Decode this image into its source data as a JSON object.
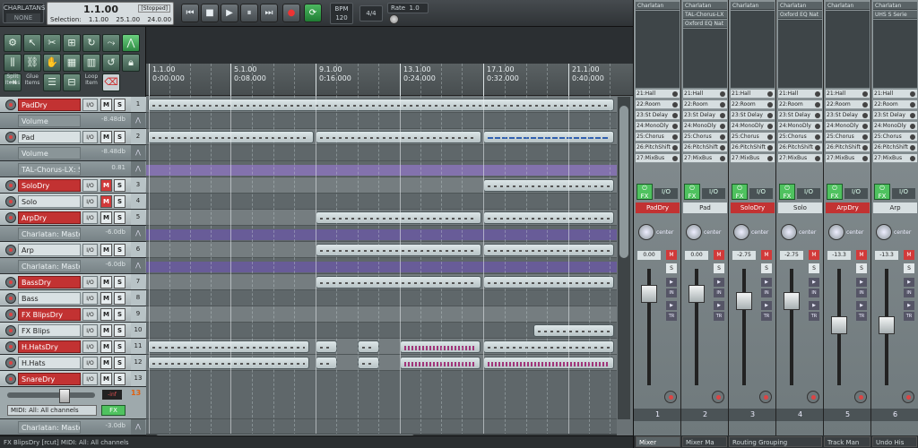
{
  "transport": {
    "project_name": "CHARLATANS",
    "project_sub": "NONE",
    "time_position": "1.1.00",
    "time_status": "[Stopped]",
    "selection_label": "Selection:",
    "selection_start": "1.1.00",
    "selection_end": "25.1.00",
    "selection_length": "24.0.00",
    "bpm_label": "BPM",
    "bpm_value": "120",
    "time_signature": "4/4",
    "rate_label": "Rate",
    "rate_value": "1.0",
    "buttons": {
      "go_start": "⏮",
      "stop": "■",
      "play": "▶",
      "pause": "⏸",
      "go_end": "⏭",
      "record": "●",
      "loop": "⟳"
    }
  },
  "toolbar": {
    "labels": [
      "Split Items",
      "Glue Items",
      "",
      "Loop Item"
    ]
  },
  "ruler": {
    "marks": [
      {
        "measure": "1.1.00",
        "time": "0:00.000"
      },
      {
        "measure": "5.1.00",
        "time": "0:08.000"
      },
      {
        "measure": "9.1.00",
        "time": "0:16.000"
      },
      {
        "measure": "13.1.00",
        "time": "0:24.000"
      },
      {
        "measure": "17.1.00",
        "time": "0:32.000"
      },
      {
        "measure": "21.1.00",
        "time": "0:40.000"
      }
    ]
  },
  "tracks": [
    {
      "name": "PadDry",
      "armed": true,
      "io": "I/O",
      "m": "M",
      "s": "S",
      "num": "1",
      "mute": false
    },
    {
      "name": "Volume",
      "env": true,
      "value": "-8.48db"
    },
    {
      "name": "Pad",
      "armed": false,
      "io": "I/O",
      "m": "M",
      "s": "S",
      "num": "2",
      "mute": false
    },
    {
      "name": "Volume",
      "env": true,
      "value": "-8.48db"
    },
    {
      "name": "TAL-Chorus-LX: ST",
      "env": true,
      "value": "0.81"
    },
    {
      "name": "SoloDry",
      "armed": true,
      "io": "I/O",
      "m": "M",
      "s": "S",
      "num": "3",
      "mute": true
    },
    {
      "name": "Solo",
      "armed": false,
      "io": "I/O",
      "m": "M",
      "s": "S",
      "num": "4",
      "mute": true
    },
    {
      "name": "ArpDry",
      "armed": true,
      "io": "I/O",
      "m": "M",
      "s": "S",
      "num": "5",
      "mute": false
    },
    {
      "name": "Charlatan: Master V",
      "env": true,
      "value": "-6.0db"
    },
    {
      "name": "Arp",
      "armed": false,
      "io": "I/O",
      "m": "M",
      "s": "S",
      "num": "6",
      "mute": false
    },
    {
      "name": "Charlatan: Master V",
      "env": true,
      "value": "-6.0db"
    },
    {
      "name": "BassDry",
      "armed": true,
      "io": "I/O",
      "m": "M",
      "s": "S",
      "num": "7",
      "mute": false
    },
    {
      "name": "Bass",
      "armed": false,
      "io": "I/O",
      "m": "M",
      "s": "S",
      "num": "8",
      "mute": false
    },
    {
      "name": "FX BlipsDry",
      "armed": true,
      "io": "I/O",
      "m": "M",
      "s": "S",
      "num": "9",
      "mute": false
    },
    {
      "name": "FX Blips",
      "armed": false,
      "io": "I/O",
      "m": "M",
      "s": "S",
      "num": "10",
      "mute": false
    },
    {
      "name": "H.HatsDry",
      "armed": true,
      "io": "I/O",
      "m": "M",
      "s": "S",
      "num": "11",
      "mute": false
    },
    {
      "name": "H.Hats",
      "armed": false,
      "io": "I/O",
      "m": "M",
      "s": "S",
      "num": "12",
      "mute": false
    },
    {
      "name": "SnareDry",
      "armed": true,
      "io": "I/O",
      "m": "M",
      "s": "S",
      "num": "13",
      "mute": false
    }
  ],
  "snare_expanded": {
    "volume": "-inf",
    "midi_input": "MIDI: All: All channels",
    "fx": "FX",
    "num": "13"
  },
  "last_track": {
    "name": "Charlatan: Master V",
    "value": "-3.0db"
  },
  "statusbar": {
    "text": "FX BlipsDry [rcut] MIDI: All: All channels"
  },
  "mixer": {
    "strips": [
      {
        "fx_top": [
          "Charlatan"
        ],
        "sends": [
          "21:Hall",
          "22:Room",
          "23:St Delay",
          "24:MonoDly",
          "25:Chorus",
          "26:PitchShift",
          "27:MixBus"
        ],
        "io": "I/O",
        "name": "PadDry",
        "armed": true,
        "pan": "center",
        "vol": "0.00",
        "m": "M",
        "s": "S",
        "num": "1",
        "fader_pos": 0.16
      },
      {
        "fx_top": [
          "Charlatan",
          "TAL-Chorus-LX",
          "Oxford EQ Nat"
        ],
        "sends": [
          "21:Hall",
          "22:Room",
          "23:St Delay",
          "24:MonoDly",
          "25:Chorus",
          "26:PitchShift",
          "27:MixBus"
        ],
        "io": "I/O",
        "name": "Pad",
        "armed": false,
        "pan": "center",
        "vol": "0.00",
        "m": "M",
        "s": "S",
        "num": "2",
        "fader_pos": 0.16
      },
      {
        "fx_top": [
          "Charlatan"
        ],
        "sends": [
          "21:Hall",
          "22:Room",
          "23:St Delay",
          "24:MonoDly",
          "25:Chorus",
          "26:PitchShift",
          "27:MixBus"
        ],
        "io": "I/O",
        "name": "SoloDry",
        "armed": true,
        "pan": "center",
        "vol": "-2.75",
        "m": "M",
        "s": "S",
        "num": "3",
        "fader_pos": 0.24
      },
      {
        "fx_top": [
          "Charlatan",
          "Oxford EQ Nat"
        ],
        "sends": [
          "21:Hall",
          "22:Room",
          "23:St Delay",
          "24:MonoDly",
          "25:Chorus",
          "26:PitchShift",
          "27:MixBus"
        ],
        "io": "I/O",
        "name": "Solo",
        "armed": false,
        "pan": "center",
        "vol": "-2.75",
        "m": "M",
        "s": "S",
        "num": "4",
        "fader_pos": 0.24
      },
      {
        "fx_top": [
          "Charlatan"
        ],
        "sends": [
          "21:Hall",
          "22:Room",
          "23:St Delay",
          "24:MonoDly",
          "25:Chorus",
          "26:PitchShift",
          "27:MixBus"
        ],
        "io": "I/O",
        "name": "ArpDry",
        "armed": true,
        "pan": "center",
        "vol": "-13.3",
        "m": "M",
        "s": "S",
        "num": "5",
        "fader_pos": 0.48
      },
      {
        "fx_top": [
          "Charlatan",
          "UHS S Serie"
        ],
        "sends": [
          "21:Hall",
          "22:Room",
          "23:St Delay",
          "24:MonoDly",
          "25:Chorus",
          "26:PitchShift",
          "27:MixBus"
        ],
        "io": "I/O",
        "name": "Arp",
        "armed": false,
        "pan": "center",
        "vol": "-13.3",
        "m": "M",
        "s": "S",
        "num": "6",
        "fader_pos": 0.48
      }
    ],
    "tabs": [
      "Mixer",
      "Mixer Ma",
      "Routing Grouping",
      "Track Man",
      "Undo His"
    ]
  }
}
